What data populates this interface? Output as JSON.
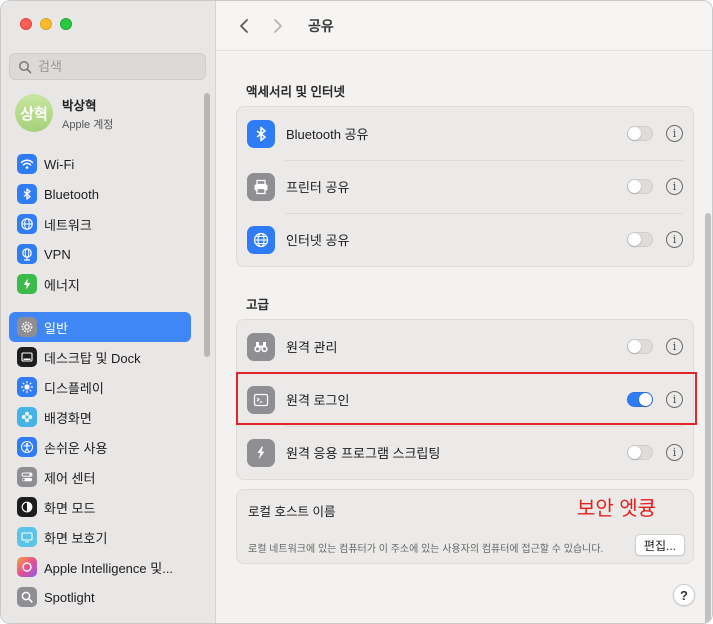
{
  "window": {
    "traffic_lights": {
      "close": "#fe5f57",
      "minimize": "#febc2e",
      "zoom": "#28c840"
    }
  },
  "search": {
    "placeholder": "검색"
  },
  "profile": {
    "avatar_text": "상혁",
    "name": "박상혁",
    "subtitle": "Apple 계정"
  },
  "sidebar": {
    "items": [
      {
        "label": "Wi-Fi",
        "icon": "wifi-icon",
        "color": "#2f7cf6"
      },
      {
        "label": "Bluetooth",
        "icon": "bluetooth-icon",
        "color": "#2f7cf6"
      },
      {
        "label": "네트워크",
        "icon": "globe-icon",
        "color": "#2f7cf6"
      },
      {
        "label": "VPN",
        "icon": "globe-icon",
        "color": "#2f7cf6"
      },
      {
        "label": "에너지",
        "icon": "bolt-icon",
        "color": "#3dbb4a"
      },
      {
        "label": "일반",
        "icon": "gear-icon",
        "color": "#8e8e93",
        "selected": true
      },
      {
        "label": "데스크탑 및 Dock",
        "icon": "dock-icon",
        "color": "#1d1d1f"
      },
      {
        "label": "디스플레이",
        "icon": "sun-icon",
        "color": "#2f7cf6"
      },
      {
        "label": "배경화면",
        "icon": "flower-icon",
        "color": "#46b3e6"
      },
      {
        "label": "손쉬운 사용",
        "icon": "accessibility-icon",
        "color": "#2f7cf6"
      },
      {
        "label": "제어 센터",
        "icon": "switches-icon",
        "color": "#8e8e93"
      },
      {
        "label": "화면 모드",
        "icon": "appearance-icon",
        "color": "#1d1d1f"
      },
      {
        "label": "화면 보호기",
        "icon": "screensaver-icon",
        "color": "#5bc3e8"
      },
      {
        "label": "Apple Intelligence 및...",
        "icon": "apple-intelligence-icon",
        "color": "#e86a9a"
      },
      {
        "label": "Spotlight",
        "icon": "magnifier-icon",
        "color": "#8e8e93"
      }
    ]
  },
  "toolbar": {
    "title": "공유"
  },
  "sections": {
    "accessories": {
      "title": "액세서리 및 인터넷",
      "rows": [
        {
          "label": "Bluetooth 공유",
          "icon": "bluetooth-icon",
          "color": "#2f7cf6",
          "enabled": false
        },
        {
          "label": "프린터 공유",
          "icon": "printer-icon",
          "color": "#8e8e93",
          "enabled": false
        },
        {
          "label": "인터넷 공유",
          "icon": "globe-icon",
          "color": "#2f7cf6",
          "enabled": false
        }
      ]
    },
    "advanced": {
      "title": "고급",
      "rows": [
        {
          "label": "원격 관리",
          "icon": "binoculars-icon",
          "color": "#8e8e93",
          "enabled": false
        },
        {
          "label": "원격 로그인",
          "icon": "terminal-icon",
          "color": "#8e8e93",
          "enabled": true
        },
        {
          "label": "원격 응용 프로그램 스크립팅",
          "icon": "script-icon",
          "color": "#8e8e93",
          "enabled": false
        }
      ]
    }
  },
  "local_host": {
    "title": "로컬 호스트 이름",
    "annotation": "보안 엣큥",
    "description": "로컬 네트워크에 있는 컴퓨터가 이 주소에 있는 사용자의 컴퓨터에 접근할 수 있습니다.",
    "edit_label": "편집..."
  },
  "help": {
    "label": "?"
  },
  "info_glyph": "i"
}
